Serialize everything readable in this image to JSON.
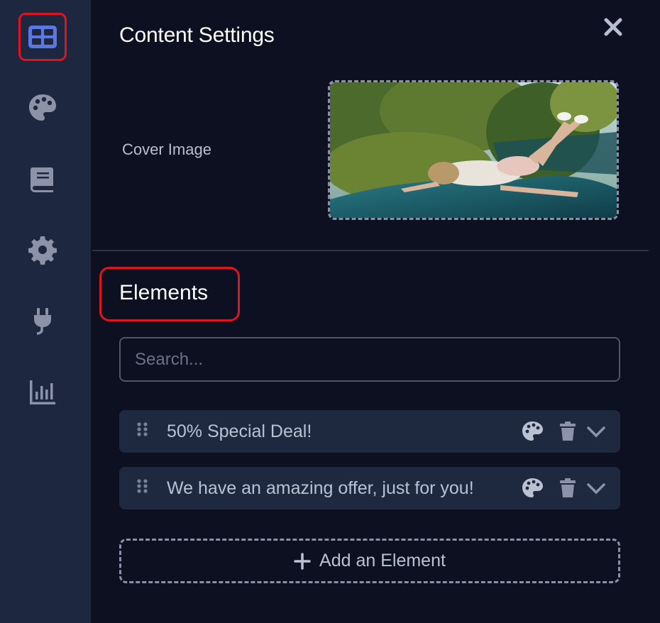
{
  "sidebar": {
    "items": [
      {
        "icon": "layout-grid-icon",
        "active": true
      },
      {
        "icon": "palette-icon",
        "active": false
      },
      {
        "icon": "book-icon",
        "active": false
      },
      {
        "icon": "gear-icon",
        "active": false
      },
      {
        "icon": "plug-icon",
        "active": false
      },
      {
        "icon": "chart-icon",
        "active": false
      }
    ]
  },
  "panel": {
    "title": "Content Settings",
    "cover_label": "Cover Image",
    "elements_title": "Elements",
    "search_placeholder": "Search...",
    "elements": [
      {
        "label": "50% Special Deal!"
      },
      {
        "label": "We have an amazing offer, just for you!"
      }
    ],
    "add_label": "Add an Element"
  },
  "colors": {
    "background": "#0d1020",
    "sidebar": "#1e2740",
    "active_icon": "#5a78e0",
    "icon": "#8c93a8",
    "highlight": "#e0141e"
  }
}
